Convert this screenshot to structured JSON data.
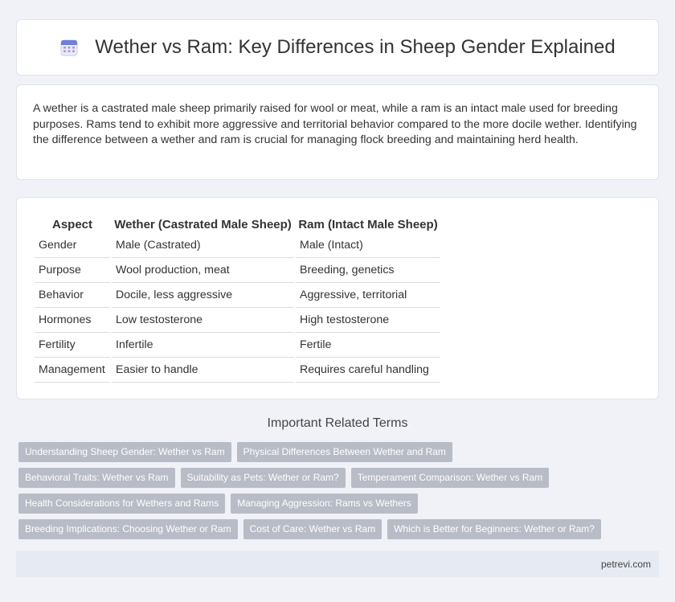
{
  "header": {
    "icon": "calendar-icon",
    "title": "Wether vs Ram: Key Differences in Sheep Gender Explained"
  },
  "intro": {
    "text": "A wether is a castrated male sheep primarily raised for wool or meat, while a ram is an intact male used for breeding purposes. Rams tend to exhibit more aggressive and territorial behavior compared to the more docile wether. Identifying the difference between a wether and ram is crucial for managing flock breeding and maintaining herd health."
  },
  "table": {
    "headers": [
      "Aspect",
      "Wether (Castrated Male Sheep)",
      "Ram (Intact Male Sheep)"
    ],
    "rows": [
      [
        "Gender",
        "Male (Castrated)",
        "Male (Intact)"
      ],
      [
        "Purpose",
        "Wool production, meat",
        "Breeding, genetics"
      ],
      [
        "Behavior",
        "Docile, less aggressive",
        "Aggressive, territorial"
      ],
      [
        "Hormones",
        "Low testosterone",
        "High testosterone"
      ],
      [
        "Fertility",
        "Infertile",
        "Fertile"
      ],
      [
        "Management",
        "Easier to handle",
        "Requires careful handling"
      ]
    ]
  },
  "related": {
    "title": "Important Related Terms",
    "tags": [
      "Understanding Sheep Gender: Wether vs Ram",
      "Physical Differences Between Wether and Ram",
      "Behavioral Traits: Wether vs Ram",
      "Suitability as Pets: Wether or Ram?",
      "Temperament Comparison: Wether vs Ram",
      "Health Considerations for Wethers and Rams",
      "Managing Aggression: Rams vs Wethers",
      "Breeding Implications: Choosing Wether or Ram",
      "Cost of Care: Wether vs Ram",
      "Which is Better for Beginners: Wether or Ram?"
    ]
  },
  "footer": {
    "site": "petrevi.com"
  },
  "colors": {
    "background": "#f0f2f8",
    "tag_bg": "#b7bcc6",
    "footer_bg": "#e6eaf3"
  }
}
